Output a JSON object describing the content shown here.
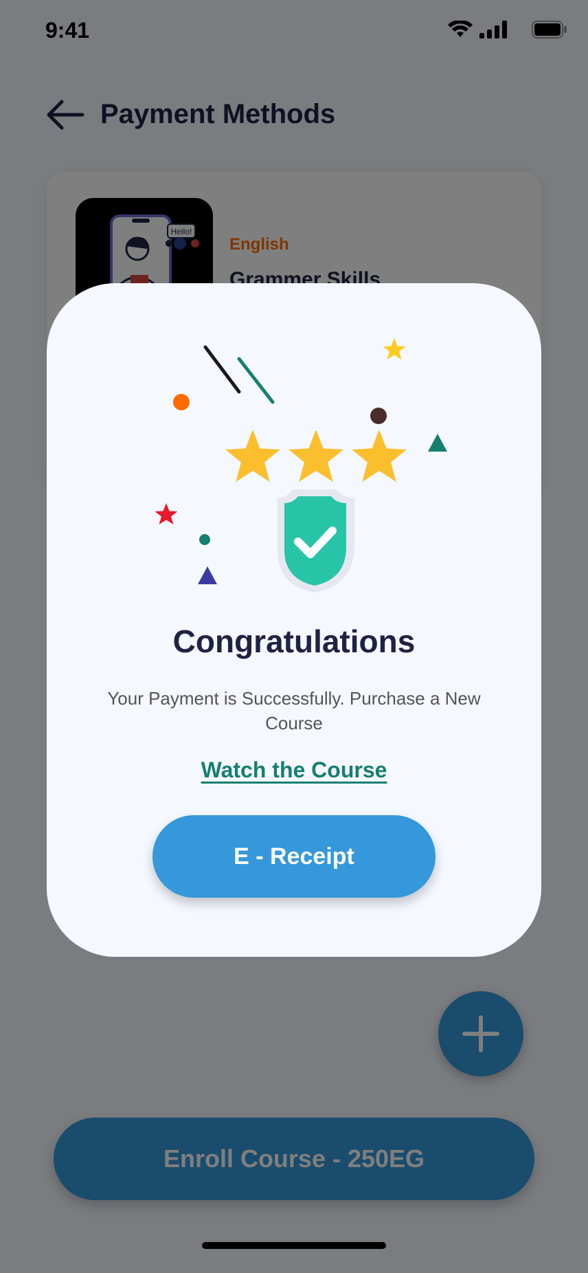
{
  "status_bar": {
    "time": "9:41"
  },
  "header": {
    "title": "Payment Methods"
  },
  "course": {
    "category": "English",
    "title": "Grammer Skills",
    "thumb_bubble": "Hello!"
  },
  "enroll_button": {
    "label": "Enroll Course - 250EG"
  },
  "modal": {
    "title": "Congratulations",
    "message": "Your Payment is Successfully. Purchase a New Course",
    "link": "Watch the Course",
    "receipt_label": "E - Receipt",
    "rating": 3
  },
  "colors": {
    "primary": "#3498db",
    "dark": "#202244",
    "accent_orange": "#ff6b00",
    "teal": "#167f71",
    "star": "#fbbf2e",
    "shield": "#27c4a7"
  },
  "icons": [
    "back-arrow-icon",
    "signal-icon",
    "wifi-icon",
    "battery-icon",
    "plus-icon",
    "shield-check-icon",
    "star-icon"
  ]
}
